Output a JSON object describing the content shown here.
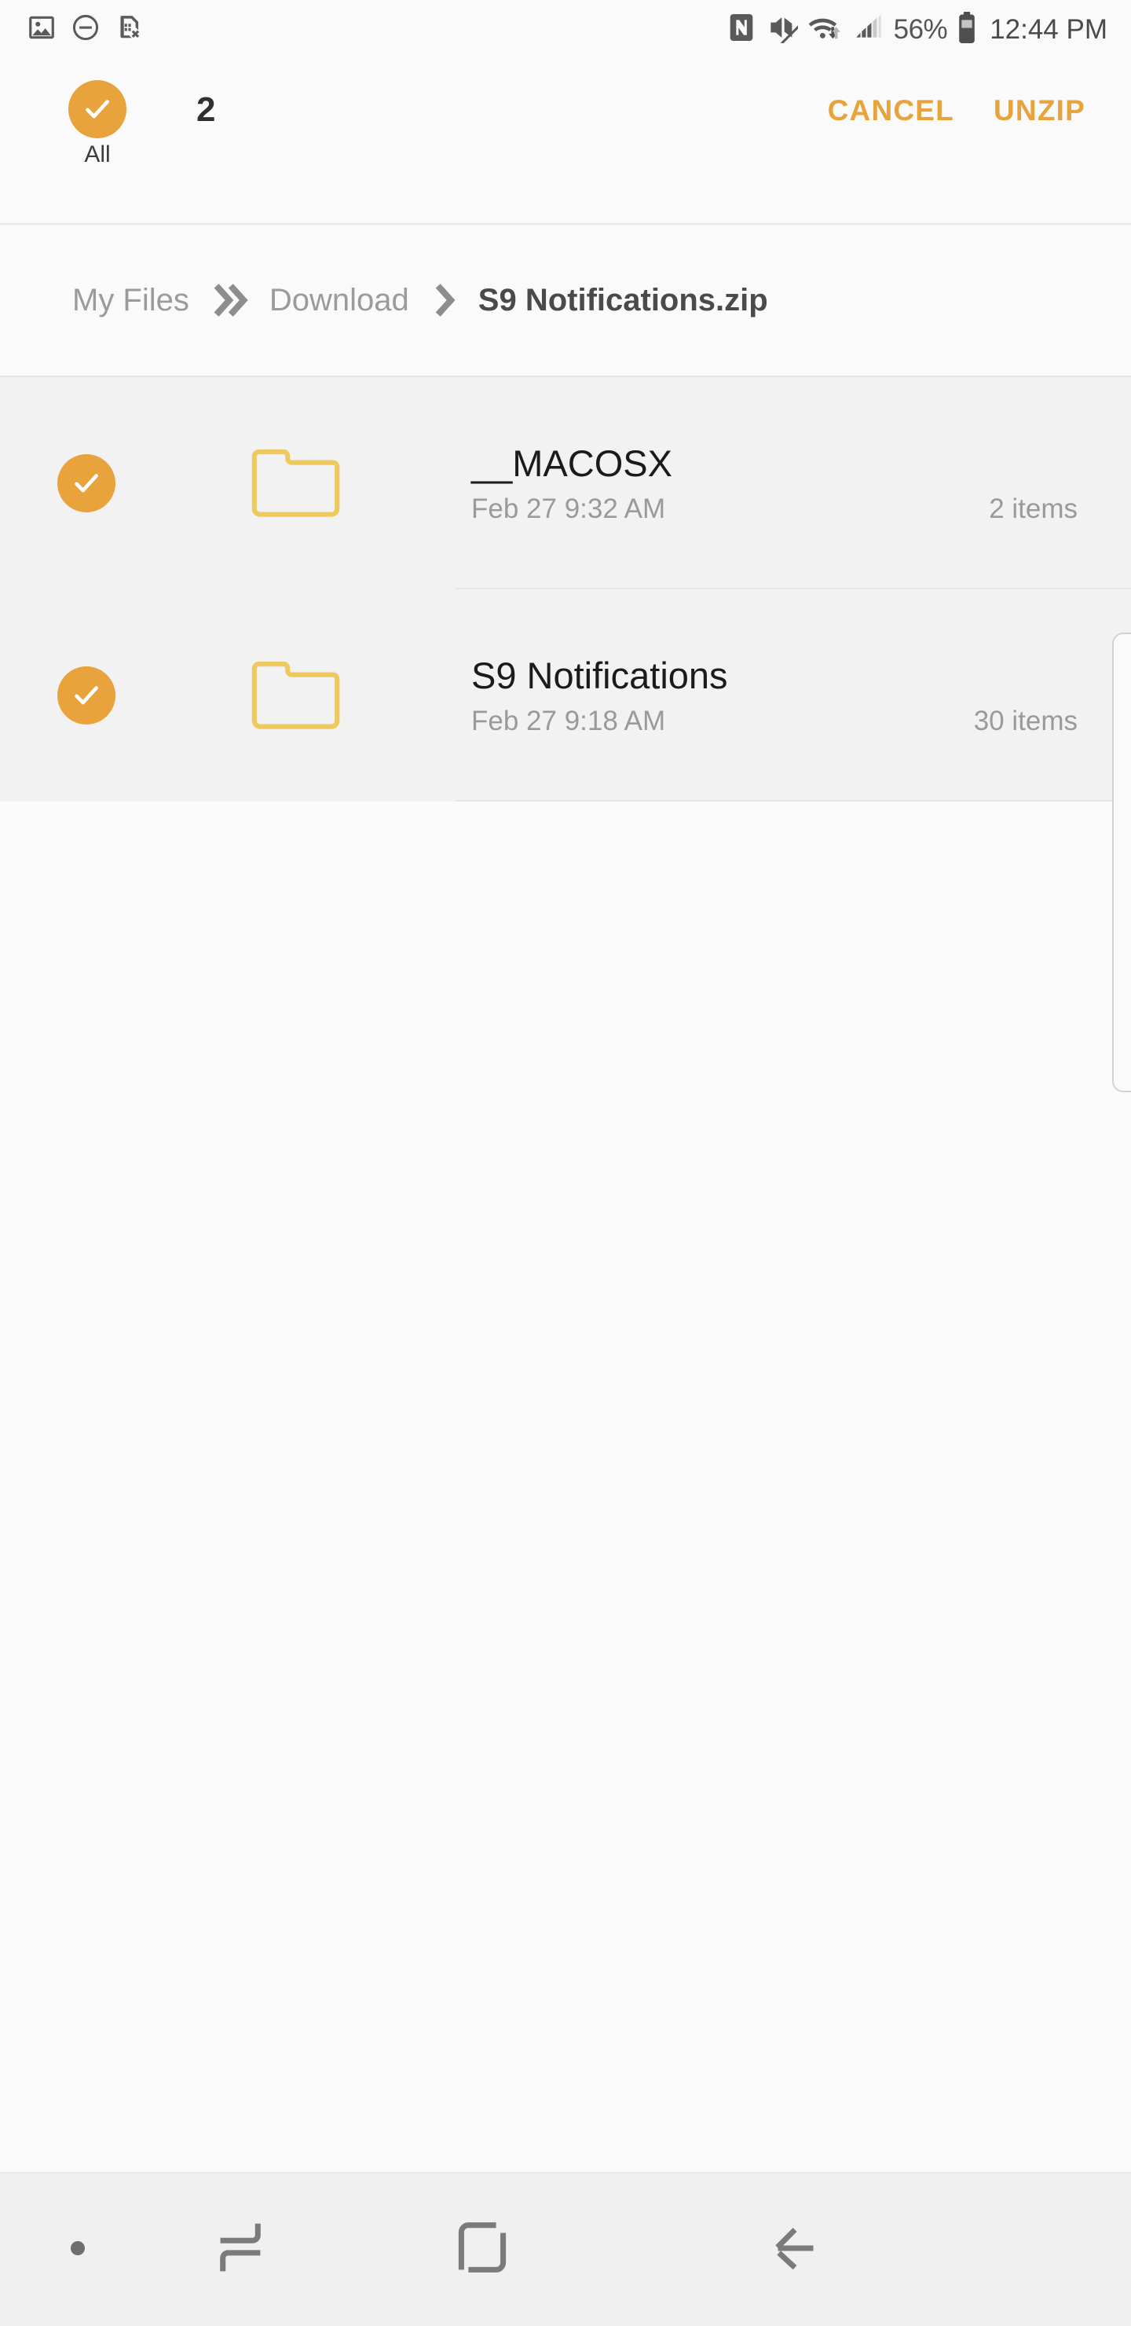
{
  "status_bar": {
    "left_icons": [
      {
        "name": "gallery-image-icon",
        "label": "Gallery"
      },
      {
        "name": "do-not-disturb-icon",
        "label": "Do not disturb"
      },
      {
        "name": "no-sim-card-icon",
        "label": "No SIM card"
      }
    ],
    "right_icons": [
      {
        "name": "nfc-icon",
        "label": "NFC"
      },
      {
        "name": "mute-icon",
        "label": "Sound muted"
      },
      {
        "name": "wifi-data-transfer-icon",
        "label": "Wi-Fi"
      },
      {
        "name": "signal-bars-icon",
        "label": "Signal"
      }
    ],
    "battery_percent": "56%",
    "clock": "12:44 PM"
  },
  "toolbar": {
    "select_all_label": "All",
    "selected_count": "2",
    "cancel_label": "CANCEL",
    "unzip_label": "UNZIP"
  },
  "breadcrumb": {
    "items": [
      {
        "label": "My Files",
        "active": false
      },
      {
        "label": "Download",
        "active": false
      },
      {
        "label": "S9 Notifications.zip",
        "active": true
      }
    ]
  },
  "file_list": {
    "rows": [
      {
        "name": "__MACOSX",
        "date": "Feb 27 9:32 AM",
        "items": "2 items",
        "icon": "folder-icon",
        "selected": true
      },
      {
        "name": "S9 Notifications",
        "date": "Feb 27 9:18 AM",
        "items": "30 items",
        "icon": "folder-icon",
        "selected": true
      }
    ]
  },
  "nav_bar": {
    "buttons": [
      {
        "name": "menu-dot-icon",
        "label": "Dot"
      },
      {
        "name": "recents-icon",
        "label": "Recents"
      },
      {
        "name": "home-icon",
        "label": "Home"
      },
      {
        "name": "back-icon",
        "label": "Back"
      }
    ]
  },
  "colors": {
    "accent": "#e8a33d",
    "folder_outline": "#eec95f",
    "selected_row_bg": "#f2f2f2",
    "page_bg": "#fafafa",
    "nav_bg": "#f0f0f0",
    "icon_gray": "#808080"
  }
}
